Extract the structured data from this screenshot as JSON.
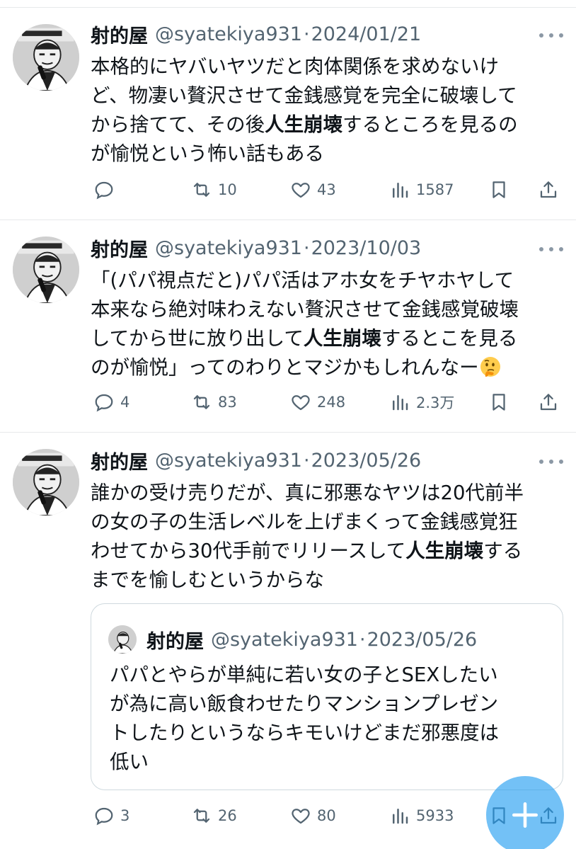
{
  "tweets": [
    {
      "name": "射的屋",
      "handle": "@syatekiya931",
      "separator": "·",
      "date": "2024/01/21",
      "lines": [
        {
          "a": "本格的にヤバいヤツだと肉体関係を求めないけ",
          "b": "",
          "c": ""
        },
        {
          "a": "ど、物凄い贅沢させて金銭感覚を完全に破壊して",
          "b": "",
          "c": ""
        },
        {
          "a": "から捨てて、その後",
          "b": "人生崩壊",
          "c": "するところを見るの"
        },
        {
          "a": "が愉悦という怖い話もある",
          "b": "",
          "c": ""
        }
      ],
      "replies": "",
      "retweets": "10",
      "likes": "43",
      "views": "1587"
    },
    {
      "name": "射的屋",
      "handle": "@syatekiya931",
      "separator": "·",
      "date": "2023/10/03",
      "lines": [
        {
          "a": "「(パパ視点だと)パパ活はアホ女をチヤホヤして",
          "b": "",
          "c": ""
        },
        {
          "a": "本来なら絶対味わえない贅沢させて金銭感覚破壊",
          "b": "",
          "c": ""
        },
        {
          "a": "してから世に放り出して",
          "b": "人生崩壊",
          "c": "するとこを見る"
        },
        {
          "a": "のが愉悦」ってのわりとマジかもしれんなー",
          "b": "",
          "c": ""
        }
      ],
      "emoji": "🤔",
      "replies": "4",
      "retweets": "83",
      "likes": "248",
      "views": "2.3万"
    },
    {
      "name": "射的屋",
      "handle": "@syatekiya931",
      "separator": "·",
      "date": "2023/05/26",
      "lines": [
        {
          "a": "誰かの受け売りだが、真に邪悪なヤツは20代前半",
          "b": "",
          "c": ""
        },
        {
          "a": "の女の子の生活レベルを上げまくって金銭感覚狂",
          "b": "",
          "c": ""
        },
        {
          "a": "わせてから30代手前でリリースして",
          "b": "人生崩壊",
          "c": "する"
        },
        {
          "a": "までを愉しむというからな",
          "b": "",
          "c": ""
        }
      ],
      "replies": "3",
      "retweets": "26",
      "likes": "80",
      "views": "5933"
    }
  ],
  "quote": {
    "name": "射的屋",
    "handle": "@syatekiya931",
    "separator": "·",
    "date": "2023/05/26",
    "lines": [
      "パパとやらが単純に若い女の子とSEXしたい",
      "が為に高い飯食わせたりマンションプレゼン",
      "トしたりというならキモいけどまだ邪悪度は",
      "低い"
    ]
  },
  "icons": {
    "reply": "reply-icon",
    "retweet": "retweet-icon",
    "like": "heart-icon",
    "views": "views-icon",
    "bookmark": "bookmark-icon",
    "share": "share-icon",
    "more": "more-icon",
    "compose": "compose-plus-icon"
  },
  "colors": {
    "text": "#0f1419",
    "secondary": "#536471",
    "divider": "#e7e9eb",
    "fab": "#1d9bf0"
  }
}
